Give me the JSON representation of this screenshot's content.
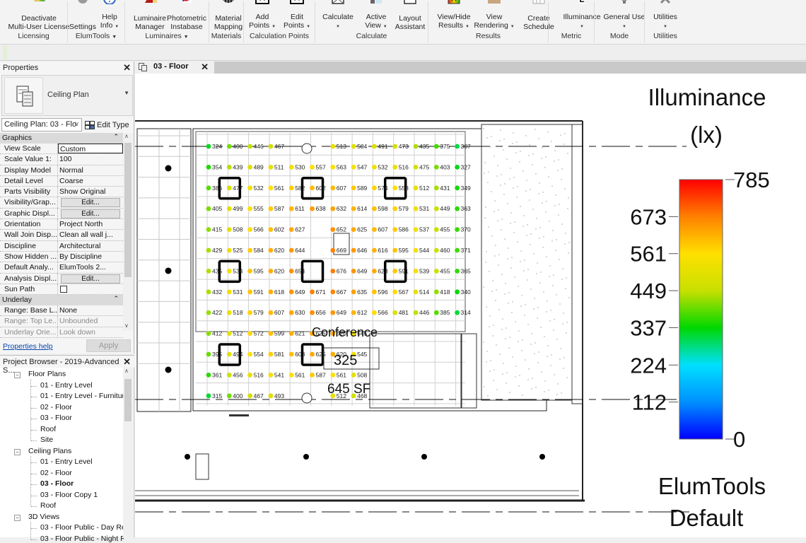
{
  "ribbon": {
    "buttons": [
      {
        "id": "deactivate",
        "line1": "Deactivate",
        "line2": "Multi-User License",
        "icon": "license-icon",
        "dropdown": false
      },
      {
        "id": "settings",
        "line1": "Settings",
        "line2": "",
        "icon": "gear-icon",
        "dropdown": false
      },
      {
        "id": "help",
        "line1": "Help",
        "line2": "Info",
        "icon": "help-icon",
        "dropdown": true
      },
      {
        "id": "luminaire-manager",
        "line1": "Luminaire",
        "line2": "Manager",
        "icon": "luminaire-icon",
        "dropdown": false
      },
      {
        "id": "photometric",
        "line1": "Photometric",
        "line2": "Instabase",
        "icon": "photometric-icon",
        "dropdown": false
      },
      {
        "id": "material-mapping",
        "line1": "Material",
        "line2": "Mapping",
        "icon": "material-icon",
        "dropdown": false
      },
      {
        "id": "add-points",
        "line1": "Add",
        "line2": "Points",
        "icon": "add-points-icon",
        "dropdown": true
      },
      {
        "id": "edit-points",
        "line1": "Edit",
        "line2": "Points",
        "icon": "edit-points-icon",
        "dropdown": true
      },
      {
        "id": "calculate",
        "line1": "Calculate",
        "line2": "",
        "icon": "calculate-icon",
        "dropdown": true
      },
      {
        "id": "active-view",
        "line1": "Active",
        "line2": "View",
        "icon": "active-view-icon",
        "dropdown": true
      },
      {
        "id": "layout-assistant",
        "line1": "Layout",
        "line2": "Assistant",
        "icon": "layout-icon",
        "dropdown": false
      },
      {
        "id": "view-hide-results",
        "line1": "View/Hide",
        "line2": "Results",
        "icon": "results-icon",
        "dropdown": true
      },
      {
        "id": "view-rendering",
        "line1": "View",
        "line2": "Rendering",
        "icon": "rendering-icon",
        "dropdown": true
      },
      {
        "id": "create-schedule",
        "line1": "Create",
        "line2": "Schedule",
        "icon": "schedule-icon",
        "dropdown": false
      },
      {
        "id": "illuminance",
        "line1": "Illuminance",
        "line2": "",
        "icon": "metric-icon",
        "dropdown": true
      },
      {
        "id": "general-use",
        "line1": "General Use",
        "line2": "",
        "icon": "bulb-icon",
        "dropdown": true
      },
      {
        "id": "utilities",
        "line1": "Utilities",
        "line2": "",
        "icon": "tools-icon",
        "dropdown": true
      }
    ],
    "groups": [
      {
        "label": "Licensing",
        "dropdown": false
      },
      {
        "label": "ElumTools",
        "dropdown": true
      },
      {
        "label": "Luminaires",
        "dropdown": true
      },
      {
        "label": "Materials",
        "dropdown": false
      },
      {
        "label": "Calculation Points",
        "dropdown": false
      },
      {
        "label": "Calculate",
        "dropdown": false
      },
      {
        "label": "Results",
        "dropdown": false
      },
      {
        "label": "Metric",
        "dropdown": false
      },
      {
        "label": "Mode",
        "dropdown": false
      },
      {
        "label": "Utilities",
        "dropdown": false
      }
    ]
  },
  "properties": {
    "title": "Properties",
    "type_name": "Ceiling Plan",
    "view_selector": "Ceiling Plan: 03 - Flo",
    "edit_type": "Edit Type",
    "sections": [
      {
        "name": "Graphics",
        "rows": [
          {
            "key": "View Scale",
            "value": "Custom",
            "kind": "boxed"
          },
          {
            "key": "Scale Value   1:",
            "value": "100",
            "kind": "text"
          },
          {
            "key": "Display Model",
            "value": "Normal",
            "kind": "text"
          },
          {
            "key": "Detail Level",
            "value": "Coarse",
            "kind": "text"
          },
          {
            "key": "Parts Visibility",
            "value": "Show Original",
            "kind": "text"
          },
          {
            "key": "Visibility/Grap...",
            "value": "Edit...",
            "kind": "button"
          },
          {
            "key": "Graphic Displ...",
            "value": "Edit...",
            "kind": "button"
          },
          {
            "key": "Orientation",
            "value": "Project North",
            "kind": "text"
          },
          {
            "key": "Wall Join Disp...",
            "value": "Clean all wall j...",
            "kind": "text"
          },
          {
            "key": "Discipline",
            "value": "Architectural",
            "kind": "text"
          },
          {
            "key": "Show Hidden ...",
            "value": "By Discipline",
            "kind": "text"
          },
          {
            "key": "Default Analy...",
            "value": "ElumTools 2...",
            "kind": "text"
          },
          {
            "key": "Analysis Displ...",
            "value": "Edit...",
            "kind": "button"
          },
          {
            "key": "Sun Path",
            "value": "",
            "kind": "checkbox"
          }
        ]
      },
      {
        "name": "Underlay",
        "rows": [
          {
            "key": "Range: Base L...",
            "value": "None",
            "kind": "text"
          },
          {
            "key": "Range: Top Le...",
            "value": "Unbounded",
            "kind": "dim"
          },
          {
            "key": "Underlay Orie...",
            "value": "Look down",
            "kind": "dim"
          }
        ]
      }
    ],
    "help_link": "Properties help",
    "apply": "Apply"
  },
  "browser": {
    "title": "Project Browser - 2019-Advanced S...",
    "groups": [
      {
        "label": "Floor Plans",
        "items": [
          "01 - Entry Level",
          "01 - Entry Level - Furnitur",
          "02 - Floor",
          "03 - Floor",
          "Roof",
          "Site"
        ]
      },
      {
        "label": "Ceiling Plans",
        "items": [
          "01 - Entry Level",
          "02 - Floor",
          "03 - Floor",
          "03 - Floor Copy 1",
          "Roof"
        ]
      },
      {
        "label": "3D Views",
        "items": [
          "03 - Floor Public - Day Re",
          "03 - Floor Public - Night Re"
        ]
      }
    ],
    "active_group": 1,
    "active_item": 2
  },
  "document_tab": {
    "label": "03 - Floor"
  },
  "plan": {
    "room_name": "Conference",
    "room_number": "325",
    "room_area": "645 SF",
    "grid_rows": [
      [
        324,
        400,
        446,
        467,
        null,
        null,
        513,
        504,
        491,
        473,
        435,
        375,
        307
      ],
      [
        354,
        439,
        489,
        511,
        530,
        557,
        563,
        547,
        532,
        516,
        475,
        403,
        327
      ],
      [
        386,
        477,
        532,
        561,
        582,
        602,
        607,
        589,
        574,
        558,
        512,
        431,
        349
      ],
      [
        405,
        499,
        555,
        587,
        611,
        638,
        632,
        614,
        598,
        579,
        531,
        449,
        363
      ],
      [
        415,
        508,
        566,
        602,
        627,
        null,
        652,
        625,
        607,
        586,
        537,
        455,
        370
      ],
      [
        429,
        525,
        584,
        620,
        644,
        null,
        669,
        646,
        616,
        595,
        544,
        460,
        371
      ],
      [
        435,
        534,
        595,
        620,
        654,
        null,
        676,
        649,
        623,
        591,
        539,
        455,
        365
      ],
      [
        432,
        531,
        591,
        618,
        649,
        671,
        667,
        635,
        596,
        567,
        514,
        418,
        340
      ],
      [
        422,
        518,
        579,
        607,
        630,
        656,
        649,
        612,
        566,
        481,
        446,
        385,
        314
      ],
      [
        412,
        512,
        572,
        599,
        621,
        625,
        620,
        545,
        null,
        null,
        null,
        null,
        null
      ],
      [
        395,
        494,
        554,
        581,
        603,
        625,
        620,
        545,
        null,
        null,
        null,
        null,
        null
      ],
      [
        361,
        456,
        516,
        541,
        561,
        587,
        561,
        508,
        null,
        null,
        null,
        null,
        null
      ],
      [
        315,
        400,
        467,
        493,
        null,
        null,
        512,
        468,
        null,
        null,
        null,
        null,
        null
      ]
    ]
  },
  "legend": {
    "title_line1": "Illuminance",
    "title_line2": "(lx)",
    "max": 785,
    "min": 0,
    "ticks": [
      785,
      673,
      561,
      449,
      337,
      224,
      112,
      0
    ],
    "stops": [
      {
        "value": 785,
        "color": "#ff0000"
      },
      {
        "value": 673,
        "color": "#ff8000"
      },
      {
        "value": 561,
        "color": "#ffe000"
      },
      {
        "value": 449,
        "color": "#c8e000"
      },
      {
        "value": 337,
        "color": "#00d800"
      },
      {
        "value": 224,
        "color": "#00e0ff"
      },
      {
        "value": 112,
        "color": "#0090ff"
      },
      {
        "value": 0,
        "color": "#0000ff"
      }
    ],
    "footer_line1": "ElumTools",
    "footer_line2": "Default"
  }
}
